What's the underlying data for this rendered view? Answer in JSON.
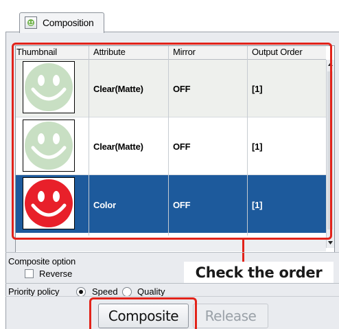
{
  "tab": {
    "label": "Composition",
    "icon": "composition-icon"
  },
  "table": {
    "columns": [
      "Thumbnail",
      "Attribute",
      "Mirror",
      "Output Order"
    ],
    "rows": [
      {
        "thumbnail": "smiley-light-green",
        "attribute": "Clear(Matte)",
        "mirror": "OFF",
        "output_order": "[1]",
        "selected": false
      },
      {
        "thumbnail": "smiley-light-green",
        "attribute": "Clear(Matte)",
        "mirror": "OFF",
        "output_order": "[1]",
        "selected": false
      },
      {
        "thumbnail": "smiley-red",
        "attribute": "Color",
        "mirror": "OFF",
        "output_order": "[1]",
        "selected": true
      }
    ]
  },
  "composite_option": {
    "label": "Composite option",
    "reverse_label": "Reverse",
    "reverse_checked": false
  },
  "priority_policy": {
    "label": "Priority policy",
    "options": [
      {
        "label": "Speed",
        "selected": true
      },
      {
        "label": "Quality",
        "selected": false
      }
    ]
  },
  "buttons": {
    "composite_label": "Composite",
    "release_label": "Release",
    "release_enabled": false
  },
  "annotation": {
    "callout": "Check the order"
  },
  "colors": {
    "accent_red": "#e2231a",
    "selection_blue": "#1d5a9c",
    "smiley_green": "#c8dfc3",
    "smiley_red": "#e8202a"
  }
}
